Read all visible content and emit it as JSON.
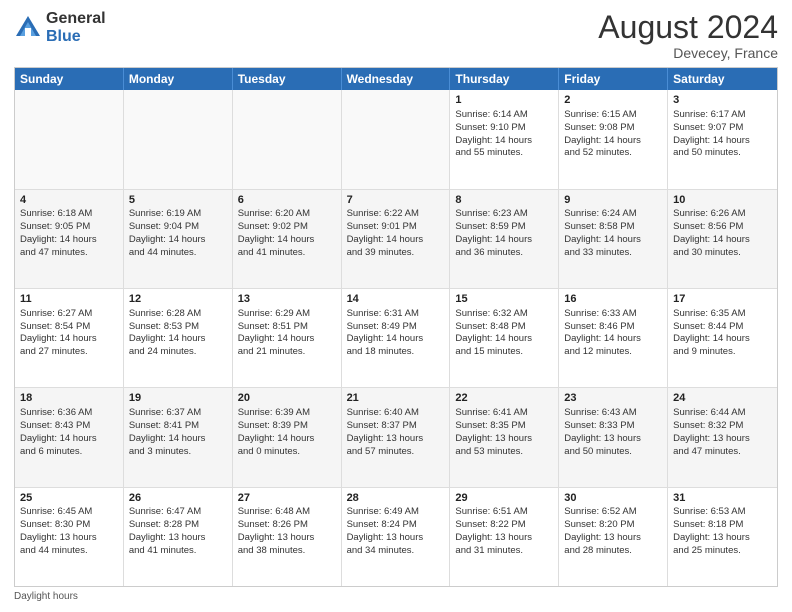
{
  "logo": {
    "general": "General",
    "blue": "Blue"
  },
  "title": "August 2024",
  "subtitle": "Devecey, France",
  "days": [
    "Sunday",
    "Monday",
    "Tuesday",
    "Wednesday",
    "Thursday",
    "Friday",
    "Saturday"
  ],
  "footer": "Daylight hours",
  "weeks": [
    [
      {
        "day": "",
        "data": ""
      },
      {
        "day": "",
        "data": ""
      },
      {
        "day": "",
        "data": ""
      },
      {
        "day": "",
        "data": ""
      },
      {
        "day": "1",
        "data": "Sunrise: 6:14 AM\nSunset: 9:10 PM\nDaylight: 14 hours\nand 55 minutes."
      },
      {
        "day": "2",
        "data": "Sunrise: 6:15 AM\nSunset: 9:08 PM\nDaylight: 14 hours\nand 52 minutes."
      },
      {
        "day": "3",
        "data": "Sunrise: 6:17 AM\nSunset: 9:07 PM\nDaylight: 14 hours\nand 50 minutes."
      }
    ],
    [
      {
        "day": "4",
        "data": "Sunrise: 6:18 AM\nSunset: 9:05 PM\nDaylight: 14 hours\nand 47 minutes."
      },
      {
        "day": "5",
        "data": "Sunrise: 6:19 AM\nSunset: 9:04 PM\nDaylight: 14 hours\nand 44 minutes."
      },
      {
        "day": "6",
        "data": "Sunrise: 6:20 AM\nSunset: 9:02 PM\nDaylight: 14 hours\nand 41 minutes."
      },
      {
        "day": "7",
        "data": "Sunrise: 6:22 AM\nSunset: 9:01 PM\nDaylight: 14 hours\nand 39 minutes."
      },
      {
        "day": "8",
        "data": "Sunrise: 6:23 AM\nSunset: 8:59 PM\nDaylight: 14 hours\nand 36 minutes."
      },
      {
        "day": "9",
        "data": "Sunrise: 6:24 AM\nSunset: 8:58 PM\nDaylight: 14 hours\nand 33 minutes."
      },
      {
        "day": "10",
        "data": "Sunrise: 6:26 AM\nSunset: 8:56 PM\nDaylight: 14 hours\nand 30 minutes."
      }
    ],
    [
      {
        "day": "11",
        "data": "Sunrise: 6:27 AM\nSunset: 8:54 PM\nDaylight: 14 hours\nand 27 minutes."
      },
      {
        "day": "12",
        "data": "Sunrise: 6:28 AM\nSunset: 8:53 PM\nDaylight: 14 hours\nand 24 minutes."
      },
      {
        "day": "13",
        "data": "Sunrise: 6:29 AM\nSunset: 8:51 PM\nDaylight: 14 hours\nand 21 minutes."
      },
      {
        "day": "14",
        "data": "Sunrise: 6:31 AM\nSunset: 8:49 PM\nDaylight: 14 hours\nand 18 minutes."
      },
      {
        "day": "15",
        "data": "Sunrise: 6:32 AM\nSunset: 8:48 PM\nDaylight: 14 hours\nand 15 minutes."
      },
      {
        "day": "16",
        "data": "Sunrise: 6:33 AM\nSunset: 8:46 PM\nDaylight: 14 hours\nand 12 minutes."
      },
      {
        "day": "17",
        "data": "Sunrise: 6:35 AM\nSunset: 8:44 PM\nDaylight: 14 hours\nand 9 minutes."
      }
    ],
    [
      {
        "day": "18",
        "data": "Sunrise: 6:36 AM\nSunset: 8:43 PM\nDaylight: 14 hours\nand 6 minutes."
      },
      {
        "day": "19",
        "data": "Sunrise: 6:37 AM\nSunset: 8:41 PM\nDaylight: 14 hours\nand 3 minutes."
      },
      {
        "day": "20",
        "data": "Sunrise: 6:39 AM\nSunset: 8:39 PM\nDaylight: 14 hours\nand 0 minutes."
      },
      {
        "day": "21",
        "data": "Sunrise: 6:40 AM\nSunset: 8:37 PM\nDaylight: 13 hours\nand 57 minutes."
      },
      {
        "day": "22",
        "data": "Sunrise: 6:41 AM\nSunset: 8:35 PM\nDaylight: 13 hours\nand 53 minutes."
      },
      {
        "day": "23",
        "data": "Sunrise: 6:43 AM\nSunset: 8:33 PM\nDaylight: 13 hours\nand 50 minutes."
      },
      {
        "day": "24",
        "data": "Sunrise: 6:44 AM\nSunset: 8:32 PM\nDaylight: 13 hours\nand 47 minutes."
      }
    ],
    [
      {
        "day": "25",
        "data": "Sunrise: 6:45 AM\nSunset: 8:30 PM\nDaylight: 13 hours\nand 44 minutes."
      },
      {
        "day": "26",
        "data": "Sunrise: 6:47 AM\nSunset: 8:28 PM\nDaylight: 13 hours\nand 41 minutes."
      },
      {
        "day": "27",
        "data": "Sunrise: 6:48 AM\nSunset: 8:26 PM\nDaylight: 13 hours\nand 38 minutes."
      },
      {
        "day": "28",
        "data": "Sunrise: 6:49 AM\nSunset: 8:24 PM\nDaylight: 13 hours\nand 34 minutes."
      },
      {
        "day": "29",
        "data": "Sunrise: 6:51 AM\nSunset: 8:22 PM\nDaylight: 13 hours\nand 31 minutes."
      },
      {
        "day": "30",
        "data": "Sunrise: 6:52 AM\nSunset: 8:20 PM\nDaylight: 13 hours\nand 28 minutes."
      },
      {
        "day": "31",
        "data": "Sunrise: 6:53 AM\nSunset: 8:18 PM\nDaylight: 13 hours\nand 25 minutes."
      }
    ]
  ]
}
